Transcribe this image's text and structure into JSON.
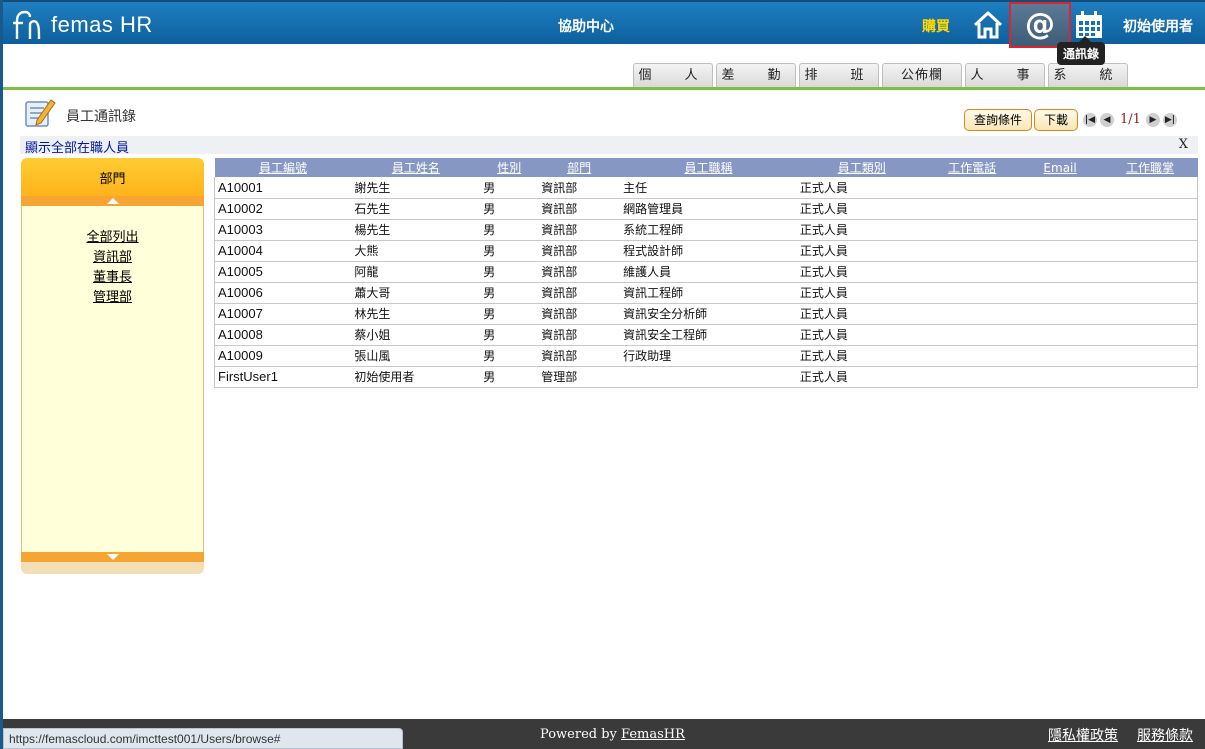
{
  "header": {
    "logo_text": "femas HR",
    "help_center": "協助中心",
    "buy": "購買",
    "user_name": "初始使用者",
    "tooltip": "通訊錄",
    "icons": [
      "home-icon",
      "at-icon",
      "calendar-icon"
    ]
  },
  "tabs": [
    "個　人",
    "差　勤",
    "排　班",
    "公佈欄",
    "人　事",
    "系　統"
  ],
  "page": {
    "title": "員工通訊錄",
    "query_button": "查詢條件",
    "download_button": "下載",
    "pager_text": "1/1",
    "show_all": "顯示全部在職人員",
    "close": "X"
  },
  "sidebar": {
    "title": "部門",
    "items": [
      "全部列出",
      "資訊部",
      "董事長",
      "管理部"
    ]
  },
  "table": {
    "headers": [
      "員工編號",
      "員工姓名",
      "性別",
      "部門",
      "員工職稱",
      "員工類別",
      "工作電話",
      "Email",
      "工作職掌"
    ],
    "rows": [
      [
        "A10001",
        "謝先生",
        "男",
        "資訊部",
        "主任",
        "正式人員",
        "",
        "",
        ""
      ],
      [
        "A10002",
        "石先生",
        "男",
        "資訊部",
        "網路管理員",
        "正式人員",
        "",
        "",
        ""
      ],
      [
        "A10003",
        "楊先生",
        "男",
        "資訊部",
        "系統工程師",
        "正式人員",
        "",
        "",
        ""
      ],
      [
        "A10004",
        "大熊",
        "男",
        "資訊部",
        "程式設計師",
        "正式人員",
        "",
        "",
        ""
      ],
      [
        "A10005",
        "阿龍",
        "男",
        "資訊部",
        "維護人員",
        "正式人員",
        "",
        "",
        ""
      ],
      [
        "A10006",
        "蕭大哥",
        "男",
        "資訊部",
        "資訊工程師",
        "正式人員",
        "",
        "",
        ""
      ],
      [
        "A10007",
        "林先生",
        "男",
        "資訊部",
        "資訊安全分析師",
        "正式人員",
        "",
        "",
        ""
      ],
      [
        "A10008",
        "蔡小姐",
        "男",
        "資訊部",
        "資訊安全工程師",
        "正式人員",
        "",
        "",
        ""
      ],
      [
        "A10009",
        "張山風",
        "男",
        "資訊部",
        "行政助理",
        "正式人員",
        "",
        "",
        ""
      ],
      [
        "FirstUser1",
        "初始使用者",
        "男",
        "管理部",
        "",
        "正式人員",
        "",
        "",
        ""
      ]
    ]
  },
  "footer": {
    "powered_prefix": "Powered by ",
    "powered_link": "FemasHR",
    "privacy": "隱私權政策",
    "terms": "服務條款"
  },
  "status_url": "https://femascloud.com/imcttest001/Users/browse#"
}
